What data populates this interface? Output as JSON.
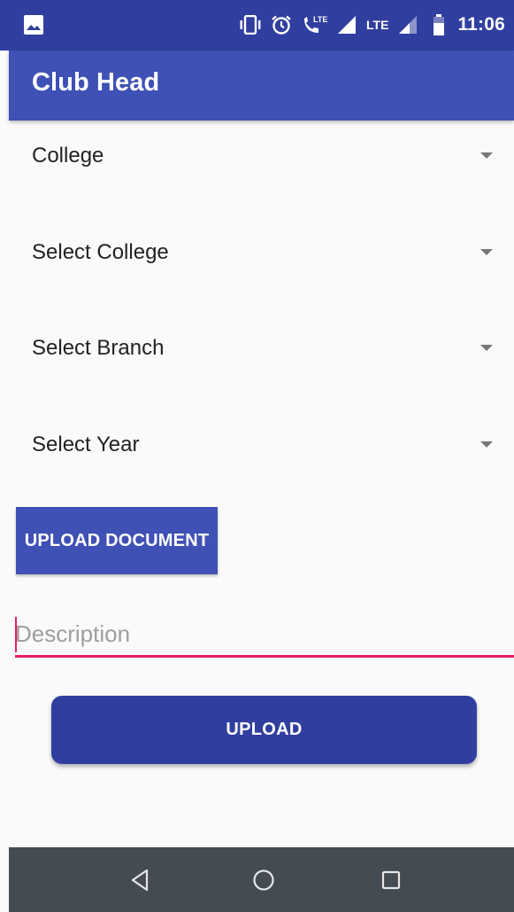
{
  "status_bar": {
    "network_1": "LTE",
    "network_2": "LTE",
    "time": "11:06"
  },
  "app_bar": {
    "title": "Club Head"
  },
  "form": {
    "spinners": [
      {
        "label": "College"
      },
      {
        "label": "Select College"
      },
      {
        "label": "Select Branch"
      },
      {
        "label": "Select Year"
      }
    ],
    "upload_document_label": "UPLOAD DOCUMENT",
    "description": {
      "placeholder": "Description",
      "value": ""
    },
    "upload_label": "UPLOAD"
  },
  "nav_bar": {
    "icons": [
      "back-icon",
      "home-icon",
      "recents-icon"
    ]
  },
  "colors": {
    "primary": "#3f51b5",
    "primary_dark": "#303f9f",
    "accent": "#e91e63",
    "nav_bar": "#454b52"
  }
}
